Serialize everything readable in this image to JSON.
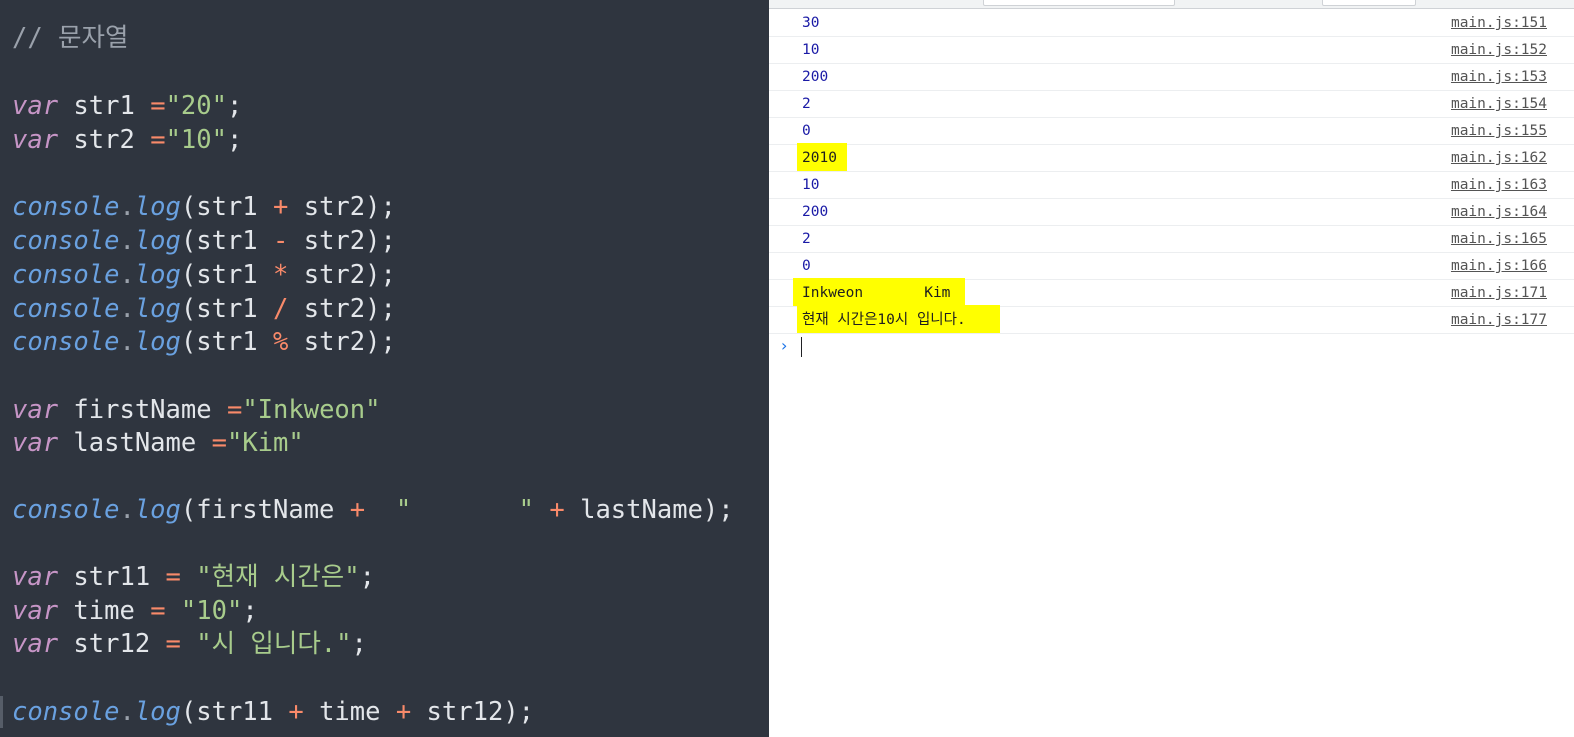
{
  "editor": {
    "comment": "// 문자열",
    "kw_var": "var",
    "str1_decl": {
      "name": "str1",
      "eq": "=",
      "value": "\"20\"",
      "end": ";"
    },
    "str2_decl": {
      "name": "str2",
      "eq": "=",
      "value": "\"10\"",
      "end": ";"
    },
    "console_obj": "console",
    "dot": ".",
    "log_fn": "log",
    "ops": {
      "plus_line": "(str1 + str2);",
      "minus_line": "(str1 - str2);",
      "mult_line": "(str1 * str2);",
      "div_line": "(str1 / str2);",
      "mod_line": "(str1 % str2);"
    },
    "firstName_decl": {
      "name": "firstName",
      "eq": "=",
      "value": "\"Inkweon\""
    },
    "lastName_decl": {
      "name": "lastName",
      "eq": "=",
      "value": "\"Kim\""
    },
    "concat_name_line": "(firstName +  \"       \" + lastName);",
    "str11_decl": {
      "name": "str11",
      "eq": "=",
      "value": "\"현재 시간은\"",
      "end": ";"
    },
    "time_decl": {
      "name": "time",
      "eq": "=",
      "value": "\"10\"",
      "end": ";"
    },
    "str12_decl": {
      "name": "str12",
      "eq": "=",
      "value": "\"시 입니다.\"",
      "end": ";"
    },
    "concat_time_line": "(str11 + time + str12);"
  },
  "console": {
    "rows": [
      {
        "value": "30",
        "source": "main.js:151"
      },
      {
        "value": "10",
        "source": "main.js:152"
      },
      {
        "value": "200",
        "source": "main.js:153"
      },
      {
        "value": "2",
        "source": "main.js:154"
      },
      {
        "value": "0",
        "source": "main.js:155"
      },
      {
        "value": "2010",
        "source": "main.js:162"
      },
      {
        "value": "10",
        "source": "main.js:163"
      },
      {
        "value": "200",
        "source": "main.js:164"
      },
      {
        "value": "2",
        "source": "main.js:165"
      },
      {
        "value": "0",
        "source": "main.js:166"
      },
      {
        "value": "Inkweon       Kim",
        "source": "main.js:171"
      },
      {
        "value": "현재 시간은10시 입니다.",
        "source": "main.js:177"
      }
    ],
    "prompt_symbol": "›"
  },
  "colors": {
    "editor_bg": "#2f353f",
    "keyword": "#c695c6",
    "function": "#6aa1e0",
    "string": "#a8cc8c",
    "operator": "#f98a6a",
    "console_number": "#1a1aa6",
    "highlight": "#ffff00"
  }
}
